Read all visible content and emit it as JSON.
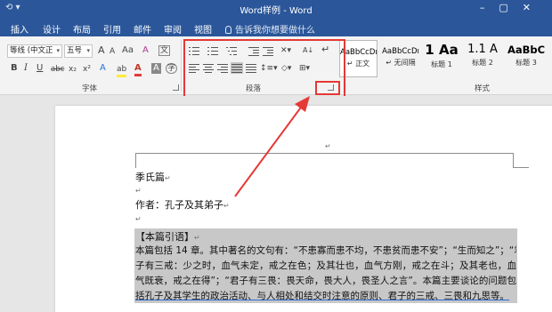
{
  "window": {
    "title": "Word样例 - Word",
    "controls": [
      "–",
      "▢",
      "✕"
    ]
  },
  "tabs": [
    {
      "label": "插入"
    },
    {
      "label": "设计"
    },
    {
      "label": "布局"
    },
    {
      "label": "引用"
    },
    {
      "label": "邮件"
    },
    {
      "label": "审阅"
    },
    {
      "label": "视图"
    }
  ],
  "tell_me": "告诉我你想要做什么",
  "ribbon": {
    "font": {
      "font_name": "等线 (中文正",
      "font_size": "五号",
      "grow": "A",
      "shrink": "A",
      "case": "Aa",
      "clear": "A",
      "wen": "文",
      "bold": "B",
      "italic": "I",
      "underline": "U",
      "strike": "abc",
      "subscript": "x₂",
      "superscript": "x²",
      "effects": "A",
      "highlight": "ab",
      "color": "A",
      "char_shading": "A",
      "circled": "字",
      "label": "字体"
    },
    "paragraph": {
      "sort": "A↓",
      "marks": "↵",
      "label": "段落"
    },
    "styles": {
      "items": [
        {
          "sample": "AaBbCcDı",
          "label": "↵ 正文"
        },
        {
          "sample": "AaBbCcDı",
          "label": "↵ 无间隔"
        },
        {
          "sample": "1 Aa",
          "label": "标题 1"
        },
        {
          "sample": "1.1 A",
          "label": "标题 2"
        },
        {
          "sample": "AaBbC",
          "label": "标题 3"
        }
      ],
      "label": "样式"
    }
  },
  "document": {
    "title_line": "季氏篇",
    "author_line": "作者：孔子及其弟子",
    "section_heading": "【本篇引语】",
    "body_lines": [
      "本篇包括 14 章。其中著名的文句有：“不患寡而患不均，不患贫而患不安”；“生而知之”；“君",
      "子有三戒：少之时，血气未定，戒之在色；及其壮也，血气方刚，戒之在斗；及其老也，血",
      "气既衰，戒之在得”；“君子有三畏：畏天命，畏大人，畏圣人之言”。本篇主要谈论的问题包",
      "括孔子及其学生的政治活动、与人相处和结交时注意的原则、君子的三戒、三畏和九思等。"
    ],
    "return_mark": "↵"
  }
}
